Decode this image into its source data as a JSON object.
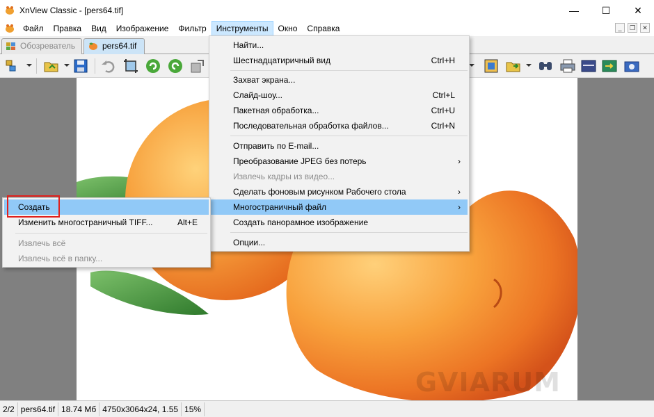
{
  "window": {
    "title": "XnView Classic - [pers64.tif]"
  },
  "window_controls": {
    "minimize": "—",
    "maximize": "☐",
    "close": "✕"
  },
  "menubar": {
    "items": [
      "Файл",
      "Правка",
      "Вид",
      "Изображение",
      "Фильтр",
      "Инструменты",
      "Окно",
      "Справка"
    ],
    "active_index": 5
  },
  "mdi_controls": {
    "minimize": "_",
    "restore": "❐",
    "close": "✕"
  },
  "tabs": [
    {
      "label": "Обозреватель",
      "active": false
    },
    {
      "label": "pers64.tif",
      "active": true
    }
  ],
  "tools_menu": {
    "items": [
      {
        "label": "Найти...",
        "shortcut": ""
      },
      {
        "label": "Шестнадцатиричный вид",
        "shortcut": "Ctrl+H"
      },
      {
        "label": "Захват экрана...",
        "shortcut": ""
      },
      {
        "label": "Слайд-шоу...",
        "shortcut": "Ctrl+L"
      },
      {
        "label": "Пакетная обработка...",
        "shortcut": "Ctrl+U"
      },
      {
        "label": "Последовательная обработка файлов...",
        "shortcut": "Ctrl+N"
      },
      {
        "label": "Отправить по E-mail...",
        "shortcut": ""
      },
      {
        "label": "Преобразование JPEG без потерь",
        "shortcut": "",
        "submenu": true
      },
      {
        "label": "Извлечь кадры из видео...",
        "shortcut": "",
        "disabled": true
      },
      {
        "label": "Сделать фоновым рисунком Рабочего стола",
        "shortcut": "",
        "submenu": true
      },
      {
        "label": "Многостраничный файл",
        "shortcut": "",
        "submenu": true,
        "highlighted": true
      },
      {
        "label": "Создать панорамное изображение",
        "shortcut": ""
      },
      {
        "label": "Опции...",
        "shortcut": ""
      }
    ],
    "submenu_arrow": "›"
  },
  "multipage_submenu": {
    "items": [
      {
        "label": "Создать",
        "shortcut": "",
        "highlighted": true
      },
      {
        "label": "Изменить многостраничный TIFF...",
        "shortcut": "Alt+E"
      },
      {
        "label": "Извлечь всё",
        "disabled": true
      },
      {
        "label": "Извлечь всё в папку...",
        "disabled": true
      }
    ]
  },
  "watermark": "GVIARUM",
  "statusbar": {
    "page": "2/2",
    "filename": "pers64.tif",
    "size": "18.74 Мб",
    "dimensions": "4750x3064x24, 1.55",
    "zoom": "15%"
  },
  "colors": {
    "menu_active_bg": "#cce8ff",
    "highlight": "#91c9f7",
    "viewer_bg": "#808080",
    "annotation_red": "#e0201c",
    "peach_orange": "#f59a3c",
    "leaf_green": "#3e8a3a"
  },
  "icons": {
    "app": "xnview-app-icon",
    "toolbar": [
      "browser-icon",
      "open-folder-icon",
      "save-icon",
      "undo-icon",
      "crop-icon",
      "rotate-left-icon",
      "rotate-right-icon",
      "resize-icon",
      "fit-window-icon",
      "open-with-icon",
      "find-icon",
      "print-icon",
      "scanner-icon",
      "export-icon",
      "capture-icon"
    ]
  }
}
